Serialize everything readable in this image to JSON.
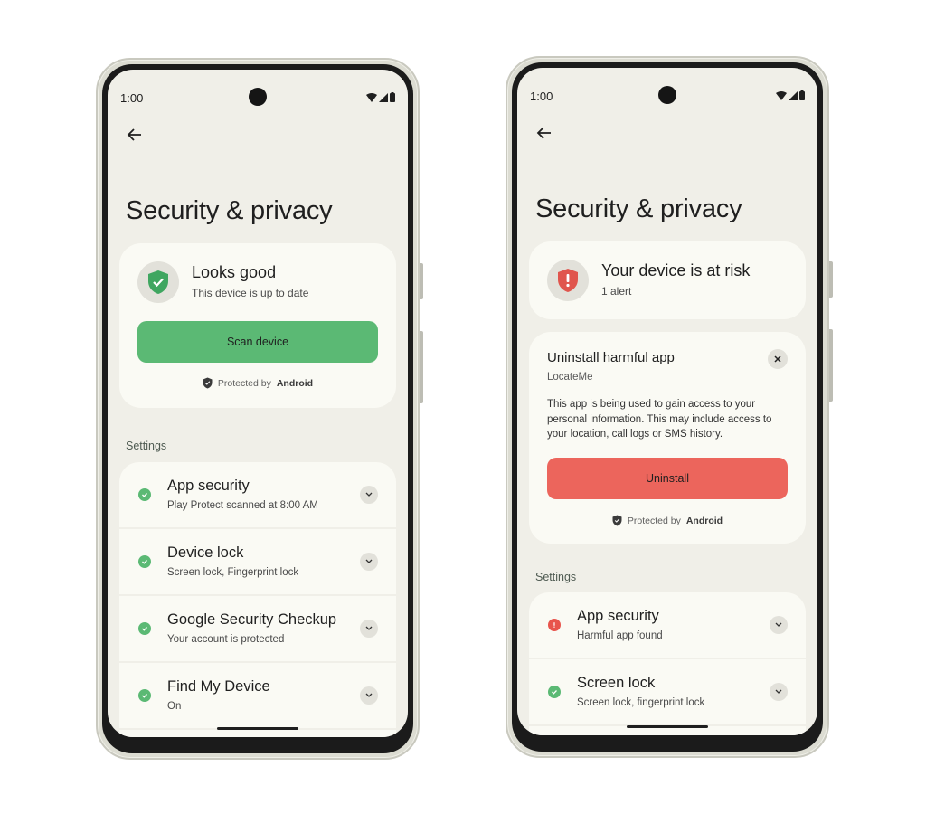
{
  "colors": {
    "screen_bg": "#f0efe8",
    "card_bg": "#fafaf4",
    "success_green": "#5bb974",
    "danger_red": "#ec655c",
    "icon_circle_bg": "#e2e1da"
  },
  "phones": [
    {
      "status_bar": {
        "time": "1:00",
        "icons": [
          "wifi-icon",
          "signal-icon",
          "battery-icon"
        ]
      },
      "back_icon": "arrow-left-icon",
      "title": "Security & privacy",
      "status_card": {
        "icon": "shield-check-icon",
        "title": "Looks good",
        "subtitle": "This device is up to date",
        "button_label": "Scan device",
        "protected_prefix": "Protected by",
        "protected_brand": "Android"
      },
      "settings_label": "Settings",
      "settings_items": [
        {
          "title": "App security",
          "subtitle": "Play Protect scanned at 8:00 AM",
          "status": "ok"
        },
        {
          "title": "Device lock",
          "subtitle": "Screen lock, Fingerprint lock",
          "status": "ok"
        },
        {
          "title": "Google Security Checkup",
          "subtitle": "Your account is protected",
          "status": "ok"
        },
        {
          "title": "Find My Device",
          "subtitle": "On",
          "status": "ok"
        }
      ]
    },
    {
      "status_bar": {
        "time": "1:00",
        "icons": [
          "wifi-icon",
          "signal-icon",
          "battery-icon"
        ]
      },
      "back_icon": "arrow-left-icon",
      "title": "Security & privacy",
      "status_card": {
        "icon": "shield-alert-icon",
        "title": "Your device is at risk",
        "subtitle": "1 alert"
      },
      "alert_card": {
        "title": "Uninstall harmful app",
        "app_name": "LocateMe",
        "body": "This app is being used to gain access to your personal information. This may include access to your location, call logs or SMS history.",
        "button_label": "Uninstall",
        "dismiss_icon": "close-icon",
        "protected_prefix": "Protected by",
        "protected_brand": "Android"
      },
      "settings_label": "Settings",
      "settings_items": [
        {
          "title": "App security",
          "subtitle": "Harmful app found",
          "status": "alert"
        },
        {
          "title": "Screen lock",
          "subtitle": "Screen lock, fingerprint lock",
          "status": "ok"
        }
      ]
    }
  ]
}
